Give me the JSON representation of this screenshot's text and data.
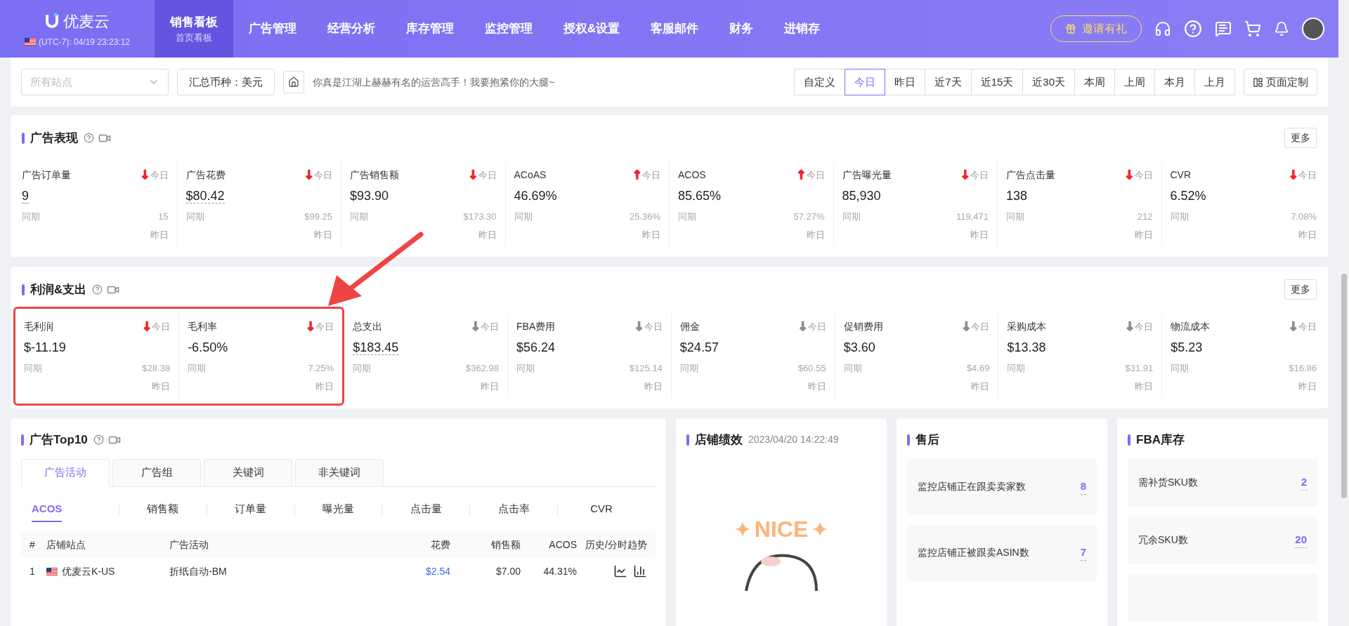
{
  "header": {
    "logo": "优麦云",
    "timezone": "(UTC-7): 04/19 23:23:12",
    "nav": [
      {
        "label": "销售看板",
        "sub": "首页看板",
        "selected": true
      },
      {
        "label": "广告管理",
        "selected": false
      },
      {
        "label": "经营分析",
        "selected": false
      },
      {
        "label": "库存管理",
        "selected": false
      },
      {
        "label": "监控管理",
        "selected": false
      },
      {
        "label": "授权&设置",
        "selected": false
      },
      {
        "label": "客服邮件",
        "selected": false
      },
      {
        "label": "财务",
        "selected": false
      },
      {
        "label": "进销存",
        "selected": false
      }
    ],
    "invite": "邀请有礼"
  },
  "filters": {
    "site_placeholder": "所有站点",
    "currency": "汇总币种：美元",
    "slogan": "你真是江湖上赫赫有名的运营高手！我要抱紧你的大腿~",
    "ranges": [
      {
        "label": "自定义",
        "selected": false
      },
      {
        "label": "今日",
        "selected": true
      },
      {
        "label": "昨日",
        "selected": false
      },
      {
        "label": "近7天",
        "selected": false
      },
      {
        "label": "近15天",
        "selected": false
      },
      {
        "label": "近30天",
        "selected": false
      },
      {
        "label": "本周",
        "selected": false
      },
      {
        "label": "上周",
        "selected": false
      },
      {
        "label": "本月",
        "selected": false
      },
      {
        "label": "上月",
        "selected": false
      }
    ],
    "customize": "页面定制"
  },
  "sections": [
    {
      "title": "广告表现",
      "more": "更多",
      "metrics": [
        {
          "label": "广告订单量",
          "trend": "↓",
          "color": "#f5222d",
          "period": "今日",
          "value": "9",
          "underlined": true,
          "compare_label": "同期",
          "compare": "15",
          "compare_period": "昨日",
          "highlighted": false
        },
        {
          "label": "广告花费",
          "trend": "↓",
          "color": "#f5222d",
          "period": "今日",
          "value": "$80.42",
          "underlined": true,
          "compare_label": "同期",
          "compare": "$99.25",
          "compare_period": "昨日",
          "highlighted": false
        },
        {
          "label": "广告销售额",
          "trend": "↓",
          "color": "#f5222d",
          "period": "今日",
          "value": "$93.90",
          "underlined": false,
          "compare_label": "同期",
          "compare": "$173.30",
          "compare_period": "昨日",
          "highlighted": false
        },
        {
          "label": "ACoAS",
          "trend": "↑",
          "color": "#f5222d",
          "period": "今日",
          "value": "46.69%",
          "underlined": false,
          "compare_label": "同期",
          "compare": "25.36%",
          "compare_period": "昨日",
          "highlighted": false
        },
        {
          "label": "ACOS",
          "trend": "↑",
          "color": "#f5222d",
          "period": "今日",
          "value": "85.65%",
          "underlined": false,
          "compare_label": "同期",
          "compare": "57.27%",
          "compare_period": "昨日",
          "highlighted": false
        },
        {
          "label": "广告曝光量",
          "trend": "↓",
          "color": "#f5222d",
          "period": "今日",
          "value": "85,930",
          "underlined": false,
          "compare_label": "同期",
          "compare": "119,471",
          "compare_period": "昨日",
          "highlighted": false
        },
        {
          "label": "广告点击量",
          "trend": "↓",
          "color": "#f5222d",
          "period": "今日",
          "value": "138",
          "underlined": false,
          "compare_label": "同期",
          "compare": "212",
          "compare_period": "昨日",
          "highlighted": false
        },
        {
          "label": "CVR",
          "trend": "↓",
          "color": "#f5222d",
          "period": "今日",
          "value": "6.52%",
          "underlined": false,
          "compare_label": "同期",
          "compare": "7.08%",
          "compare_period": "昨日",
          "highlighted": false
        }
      ]
    },
    {
      "title": "利润&支出",
      "more": "更多",
      "metrics": [
        {
          "label": "毛利润",
          "trend": "↓",
          "color": "#f5222d",
          "period": "今日",
          "value": "$-11.19",
          "underlined": false,
          "compare_label": "同期",
          "compare": "$28.38",
          "compare_period": "昨日",
          "highlighted": true
        },
        {
          "label": "毛利率",
          "trend": "↓",
          "color": "#f5222d",
          "period": "今日",
          "value": "-6.50%",
          "underlined": false,
          "compare_label": "同期",
          "compare": "7.25%",
          "compare_period": "昨日",
          "highlighted": true
        },
        {
          "label": "总支出",
          "trend": "↓",
          "color": "#8c8c8c",
          "period": "今日",
          "value": "$183.45",
          "underlined": true,
          "compare_label": "同期",
          "compare": "$362.98",
          "compare_period": "昨日",
          "highlighted": false
        },
        {
          "label": "FBA费用",
          "trend": "↓",
          "color": "#8c8c8c",
          "period": "今日",
          "value": "$56.24",
          "underlined": false,
          "compare_label": "同期",
          "compare": "$125.14",
          "compare_period": "昨日",
          "highlighted": false
        },
        {
          "label": "佣金",
          "trend": "↓",
          "color": "#8c8c8c",
          "period": "今日",
          "value": "$24.57",
          "underlined": false,
          "compare_label": "同期",
          "compare": "$60.55",
          "compare_period": "昨日",
          "highlighted": false
        },
        {
          "label": "促销费用",
          "trend": "↓",
          "color": "#8c8c8c",
          "period": "今日",
          "value": "$3.60",
          "underlined": false,
          "compare_label": "同期",
          "compare": "$4.69",
          "compare_period": "昨日",
          "highlighted": false
        },
        {
          "label": "采购成本",
          "trend": "↓",
          "color": "#8c8c8c",
          "period": "今日",
          "value": "$13.38",
          "underlined": false,
          "compare_label": "同期",
          "compare": "$31.91",
          "compare_period": "昨日",
          "highlighted": false
        },
        {
          "label": "物流成本",
          "trend": "↓",
          "color": "#8c8c8c",
          "period": "今日",
          "value": "$5.23",
          "underlined": false,
          "compare_label": "同期",
          "compare": "$16.86",
          "compare_period": "昨日",
          "highlighted": false
        }
      ]
    }
  ],
  "top10": {
    "title": "广告Top10",
    "tabs": [
      {
        "label": "广告活动",
        "selected": true
      },
      {
        "label": "广告组",
        "selected": false
      },
      {
        "label": "关键词",
        "selected": false
      },
      {
        "label": "非关键词",
        "selected": false
      }
    ],
    "metric_tabs": [
      {
        "label": "ACOS",
        "selected": true
      },
      {
        "label": "销售额",
        "selected": false
      },
      {
        "label": "订单量",
        "selected": false
      },
      {
        "label": "曝光量",
        "selected": false
      },
      {
        "label": "点击量",
        "selected": false
      },
      {
        "label": "点击率",
        "selected": false
      },
      {
        "label": "CVR",
        "selected": false
      }
    ],
    "columns": [
      "#",
      "店铺站点",
      "广告活动",
      "花费",
      "销售额",
      "ACOS",
      "历史/分时趋势"
    ],
    "rows": [
      {
        "index": "1",
        "store": "优麦云K-US",
        "campaign": "折纸自动-BM",
        "spend": "$2.54",
        "sales": "$7.00",
        "acos": "44.31%"
      }
    ]
  },
  "store": {
    "title": "店铺绩效",
    "time": "2023/04/20 14:22:49",
    "sticker": "NICE"
  },
  "after_sales": {
    "title": "售后",
    "items": [
      {
        "label": "监控店铺正在跟卖卖家数",
        "value": "8"
      },
      {
        "label": "监控店铺正被跟卖ASIN数",
        "value": "7"
      }
    ]
  },
  "fba": {
    "title": "FBA库存",
    "items": [
      {
        "label": "需补货SKU数",
        "value": "2"
      },
      {
        "label": "冗余SKU数",
        "value": "20"
      }
    ]
  }
}
